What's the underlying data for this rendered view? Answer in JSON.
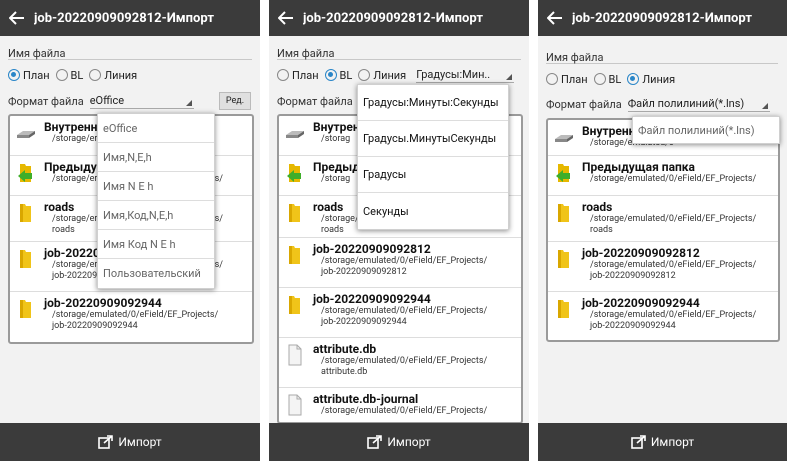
{
  "app": {
    "title": "job-20220909092812-Импорт"
  },
  "form": {
    "filename_label": "Имя файла",
    "radio_plan": "План",
    "radio_bl": "BL",
    "radio_line": "Линия",
    "format_label": "Формат файла",
    "degrees_label": "Градусы:Мин..",
    "edit_button": "Ред."
  },
  "screens": [
    {
      "format_value": "eOffice",
      "selected": "plan"
    },
    {
      "format_value": "",
      "selected": "bl"
    },
    {
      "format_value": "Файл полилиний(*.lns)",
      "selected": "line"
    }
  ],
  "files": {
    "internal_name": "Внутренняя память",
    "internal_path": "/storage/emulated/0",
    "parent_name": "Предыдущая папка",
    "parent_path": "/storage/emulated/0/eField/EF_Projects/",
    "roads_name": "roads",
    "roads_path1": "/storage/emulated/0/eField/EF_Projects/",
    "roads_path2": "roads",
    "job1_name": "job-20220909092812",
    "job1_path1": "/storage/emulated/0/eField/EF_Projects/",
    "job1_path2": "job-20220909092812",
    "job2_name": "job-20220909092944",
    "job2_path1": "/storage/emulated/0/eField/EF_Projects/",
    "job2_path2": "job-20220909092944",
    "attr_name": "attribute.db",
    "attr_path1": "/storage/emulated/0/eField/EF_Projects/",
    "attr_path2": "attribute.db",
    "journal_name": "attribute.db-journal",
    "journal_path1": "/storage/emulated/0/eField/EF_Projects/",
    "journal_path2": "attribute.db-journal"
  },
  "crop": {
    "internal_name_1": "Внутренн",
    "internal_path_1": "/storage/er",
    "parent_name_1": "Предыду",
    "parent_path_1": "/storage/er",
    "parent_tail_1": "jects/",
    "roads_path_1": "/storage/er",
    "roads_tail_1": "jects/",
    "job1_name_1": "job-20220",
    "job1_path_1": "/storage/er",
    "job1_path2_1": "job-202209",
    "job1_tail_1": "jects/",
    "internal_name_2": "Внутрен",
    "internal_path_2": "/storag",
    "parent_name_2": "Предыд",
    "parent_path_2": "/storag",
    "roads_path_2": "/storage/",
    "roads_path2_2": "roads",
    "internal_name_3": "Внутренн",
    "internal_path_3": "/storage/emulated/0"
  },
  "menu1": [
    "eOffice",
    "Имя,N,E,h",
    "Имя N E h",
    "Имя,Код,N,E,h",
    "Имя Код N E h",
    "Пользовательский"
  ],
  "menu2": [
    "Градусы:Минуты:Секунды",
    "Градусы.МинутыСекунды",
    "Градусы",
    "Секунды"
  ],
  "menu3": [
    "Файл полилиний(*.lns)"
  ],
  "bottom": {
    "import_label": "Импорт"
  }
}
